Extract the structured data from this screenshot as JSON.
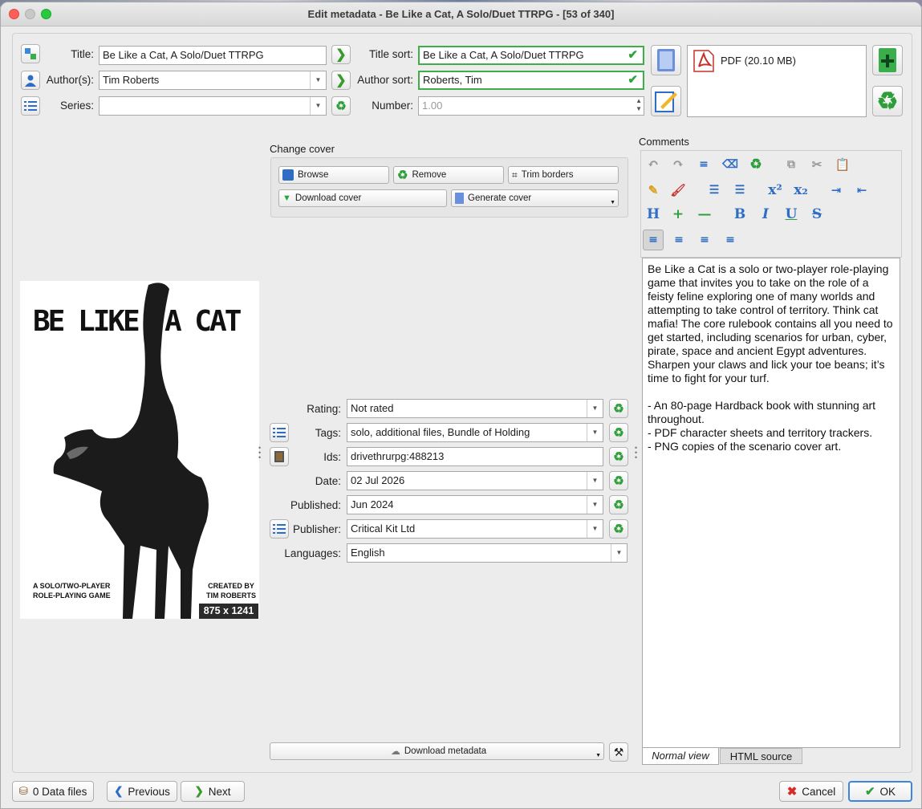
{
  "window": {
    "title": "Edit metadata - Be Like a Cat, A Solo/Duet TTRPG - [53 of 340]"
  },
  "fields": {
    "title_label": "Title:",
    "title_value": "Be Like a Cat, A Solo/Duet TTRPG",
    "authors_label": "Author(s):",
    "authors_value": "Tim Roberts",
    "series_label": "Series:",
    "series_value": "",
    "title_sort_label": "Title sort:",
    "title_sort_value": "Be Like a Cat, A Solo/Duet TTRPG",
    "author_sort_label": "Author sort:",
    "author_sort_value": "Roberts, Tim",
    "number_label": "Number:",
    "number_value": "1.00"
  },
  "formats": {
    "items": [
      {
        "label": "PDF (20.10 MB)"
      }
    ]
  },
  "cover": {
    "heading": "Change cover",
    "browse": "Browse",
    "remove": "Remove",
    "trim": "Trim borders",
    "download": "Download cover",
    "generate": "Generate cover",
    "dimensions": "875 x 1241",
    "art_title_left": "BE LIKE",
    "art_title_right": "A CAT",
    "art_sub_left_1": "A SOLO/TWO-PLAYER",
    "art_sub_left_2": "ROLE-PLAYING GAME",
    "art_sub_right_1": "CREATED BY",
    "art_sub_right_2": "TIM ROBERTS"
  },
  "meta": {
    "rating_label": "Rating:",
    "rating_value": "Not rated",
    "tags_label": "Tags:",
    "tags_value": "solo, additional files, Bundle of Holding",
    "ids_label": "Ids:",
    "ids_value": "drivethrurpg:488213",
    "date_label": "Date:",
    "date_value": "02 Jul 2026",
    "published_label": "Published:",
    "published_value": "Jun 2024",
    "publisher_label": "Publisher:",
    "publisher_value": "Critical Kit Ltd",
    "languages_label": "Languages:",
    "languages_value": "English",
    "download_metadata": "Download metadata"
  },
  "comments": {
    "heading": "Comments",
    "para1": "Be Like a Cat is a solo or two-player role-playing game that invites you to take on the role of a feisty feline exploring one of many worlds and attempting to take control of territory. Think cat mafia! The core rulebook contains all you need to get started, including scenarios for urban, cyber, pirate, space and ancient Egypt adventures. Sharpen your claws and lick your toe beans; it’s time to fight for your turf.",
    "bullet1": "- An 80-page Hardback book with stunning art throughout.",
    "bullet2": "- PDF character sheets and territory trackers.",
    "bullet3": "- PNG copies of the scenario cover art.",
    "tab_normal": "Normal view",
    "tab_html": "HTML source"
  },
  "footer": {
    "data_files": "0 Data files",
    "previous": "Previous",
    "next": "Next",
    "cancel": "Cancel",
    "ok": "OK"
  }
}
